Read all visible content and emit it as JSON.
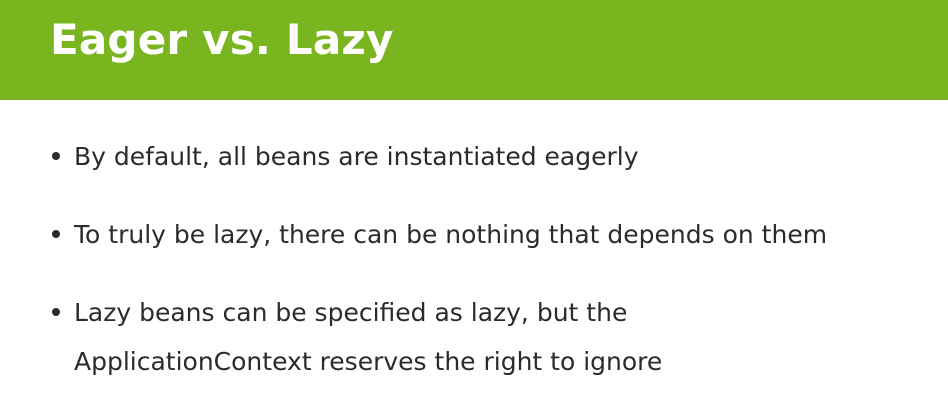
{
  "slide": {
    "title": "Eager vs. Lazy",
    "bullets": [
      "By default, all beans are instantiated eagerly",
      "To truly be lazy, there can be nothing that depends on them",
      "Lazy beans can be specified as lazy, but the ApplicationContext reserves the right to ignore"
    ]
  }
}
